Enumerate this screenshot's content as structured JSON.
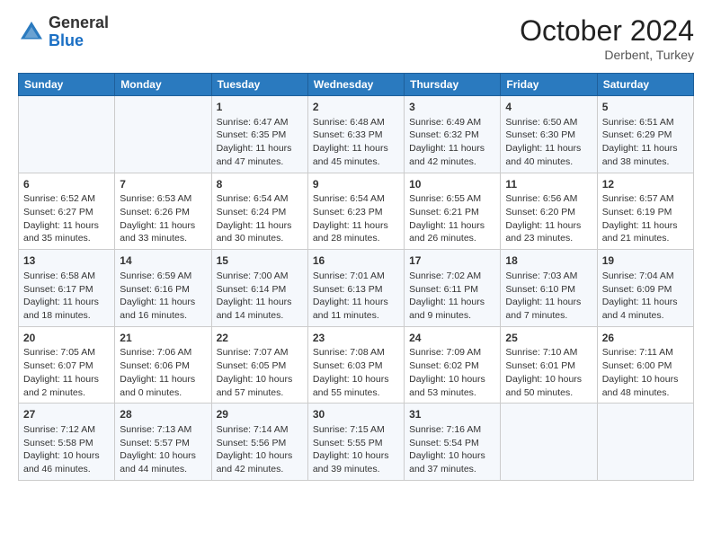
{
  "header": {
    "logo": {
      "line1": "General",
      "line2": "Blue"
    },
    "month": "October 2024",
    "location": "Derbent, Turkey"
  },
  "weekdays": [
    "Sunday",
    "Monday",
    "Tuesday",
    "Wednesday",
    "Thursday",
    "Friday",
    "Saturday"
  ],
  "weeks": [
    [
      {
        "day": "",
        "content": ""
      },
      {
        "day": "",
        "content": ""
      },
      {
        "day": "1",
        "content": "Sunrise: 6:47 AM\nSunset: 6:35 PM\nDaylight: 11 hours and 47 minutes."
      },
      {
        "day": "2",
        "content": "Sunrise: 6:48 AM\nSunset: 6:33 PM\nDaylight: 11 hours and 45 minutes."
      },
      {
        "day": "3",
        "content": "Sunrise: 6:49 AM\nSunset: 6:32 PM\nDaylight: 11 hours and 42 minutes."
      },
      {
        "day": "4",
        "content": "Sunrise: 6:50 AM\nSunset: 6:30 PM\nDaylight: 11 hours and 40 minutes."
      },
      {
        "day": "5",
        "content": "Sunrise: 6:51 AM\nSunset: 6:29 PM\nDaylight: 11 hours and 38 minutes."
      }
    ],
    [
      {
        "day": "6",
        "content": "Sunrise: 6:52 AM\nSunset: 6:27 PM\nDaylight: 11 hours and 35 minutes."
      },
      {
        "day": "7",
        "content": "Sunrise: 6:53 AM\nSunset: 6:26 PM\nDaylight: 11 hours and 33 minutes."
      },
      {
        "day": "8",
        "content": "Sunrise: 6:54 AM\nSunset: 6:24 PM\nDaylight: 11 hours and 30 minutes."
      },
      {
        "day": "9",
        "content": "Sunrise: 6:54 AM\nSunset: 6:23 PM\nDaylight: 11 hours and 28 minutes."
      },
      {
        "day": "10",
        "content": "Sunrise: 6:55 AM\nSunset: 6:21 PM\nDaylight: 11 hours and 26 minutes."
      },
      {
        "day": "11",
        "content": "Sunrise: 6:56 AM\nSunset: 6:20 PM\nDaylight: 11 hours and 23 minutes."
      },
      {
        "day": "12",
        "content": "Sunrise: 6:57 AM\nSunset: 6:19 PM\nDaylight: 11 hours and 21 minutes."
      }
    ],
    [
      {
        "day": "13",
        "content": "Sunrise: 6:58 AM\nSunset: 6:17 PM\nDaylight: 11 hours and 18 minutes."
      },
      {
        "day": "14",
        "content": "Sunrise: 6:59 AM\nSunset: 6:16 PM\nDaylight: 11 hours and 16 minutes."
      },
      {
        "day": "15",
        "content": "Sunrise: 7:00 AM\nSunset: 6:14 PM\nDaylight: 11 hours and 14 minutes."
      },
      {
        "day": "16",
        "content": "Sunrise: 7:01 AM\nSunset: 6:13 PM\nDaylight: 11 hours and 11 minutes."
      },
      {
        "day": "17",
        "content": "Sunrise: 7:02 AM\nSunset: 6:11 PM\nDaylight: 11 hours and 9 minutes."
      },
      {
        "day": "18",
        "content": "Sunrise: 7:03 AM\nSunset: 6:10 PM\nDaylight: 11 hours and 7 minutes."
      },
      {
        "day": "19",
        "content": "Sunrise: 7:04 AM\nSunset: 6:09 PM\nDaylight: 11 hours and 4 minutes."
      }
    ],
    [
      {
        "day": "20",
        "content": "Sunrise: 7:05 AM\nSunset: 6:07 PM\nDaylight: 11 hours and 2 minutes."
      },
      {
        "day": "21",
        "content": "Sunrise: 7:06 AM\nSunset: 6:06 PM\nDaylight: 11 hours and 0 minutes."
      },
      {
        "day": "22",
        "content": "Sunrise: 7:07 AM\nSunset: 6:05 PM\nDaylight: 10 hours and 57 minutes."
      },
      {
        "day": "23",
        "content": "Sunrise: 7:08 AM\nSunset: 6:03 PM\nDaylight: 10 hours and 55 minutes."
      },
      {
        "day": "24",
        "content": "Sunrise: 7:09 AM\nSunset: 6:02 PM\nDaylight: 10 hours and 53 minutes."
      },
      {
        "day": "25",
        "content": "Sunrise: 7:10 AM\nSunset: 6:01 PM\nDaylight: 10 hours and 50 minutes."
      },
      {
        "day": "26",
        "content": "Sunrise: 7:11 AM\nSunset: 6:00 PM\nDaylight: 10 hours and 48 minutes."
      }
    ],
    [
      {
        "day": "27",
        "content": "Sunrise: 7:12 AM\nSunset: 5:58 PM\nDaylight: 10 hours and 46 minutes."
      },
      {
        "day": "28",
        "content": "Sunrise: 7:13 AM\nSunset: 5:57 PM\nDaylight: 10 hours and 44 minutes."
      },
      {
        "day": "29",
        "content": "Sunrise: 7:14 AM\nSunset: 5:56 PM\nDaylight: 10 hours and 42 minutes."
      },
      {
        "day": "30",
        "content": "Sunrise: 7:15 AM\nSunset: 5:55 PM\nDaylight: 10 hours and 39 minutes."
      },
      {
        "day": "31",
        "content": "Sunrise: 7:16 AM\nSunset: 5:54 PM\nDaylight: 10 hours and 37 minutes."
      },
      {
        "day": "",
        "content": ""
      },
      {
        "day": "",
        "content": ""
      }
    ]
  ]
}
